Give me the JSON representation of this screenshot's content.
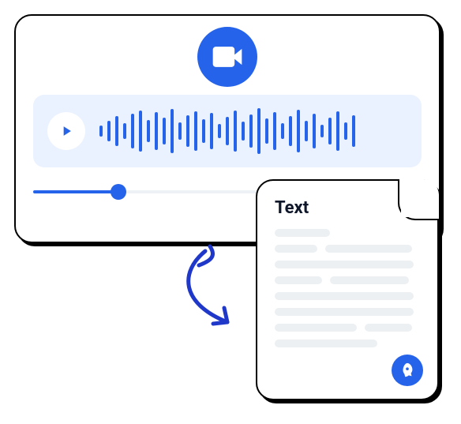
{
  "icons": {
    "video": "video-camera-icon",
    "play": "play-icon",
    "arrow": "curved-arrow-icon",
    "rocket": "rocket-icon"
  },
  "audio_card": {
    "waveform_bars": [
      14,
      26,
      38,
      20,
      44,
      52,
      28,
      48,
      34,
      56,
      22,
      40,
      50,
      30,
      46,
      18,
      36,
      52,
      24,
      42,
      58,
      32,
      48,
      20,
      38,
      54,
      26,
      44,
      16,
      34,
      50,
      22,
      40
    ],
    "progress_fraction": 0.22
  },
  "document_card": {
    "title": "Text",
    "line_rows": [
      [
        70
      ],
      [
        54,
        110
      ],
      [
        176
      ],
      [
        60,
        100
      ],
      [
        176
      ],
      [
        176
      ],
      [
        104,
        60
      ],
      [
        130
      ]
    ]
  },
  "colors": {
    "accent": "#2563eb",
    "accent_soft": "#eaf2ff",
    "line": "#edf0f3"
  }
}
